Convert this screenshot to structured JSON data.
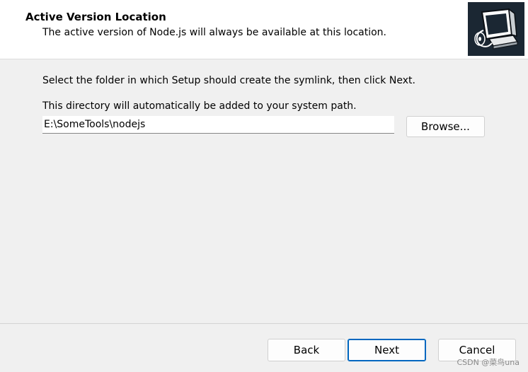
{
  "header": {
    "title": "Active Version Location",
    "subtitle": "The active version of Node.js will always be available at this location.",
    "logo_icon": "computer-setup-icon"
  },
  "main": {
    "instruction_1": "Select the folder in which Setup should create the symlink, then click Next.",
    "instruction_2": "This directory will automatically be added to your system path.",
    "path_value": "E:\\SomeTools\\nodejs",
    "browse_label": "Browse..."
  },
  "footer": {
    "back_label": "Back",
    "next_label": "Next",
    "cancel_label": "Cancel"
  },
  "watermark": "CSDN @菜鸟una",
  "colors": {
    "background": "#f0f0f0",
    "header_background": "#ffffff",
    "logo_background": "#1b2733",
    "focus_accent": "#0067c0"
  }
}
